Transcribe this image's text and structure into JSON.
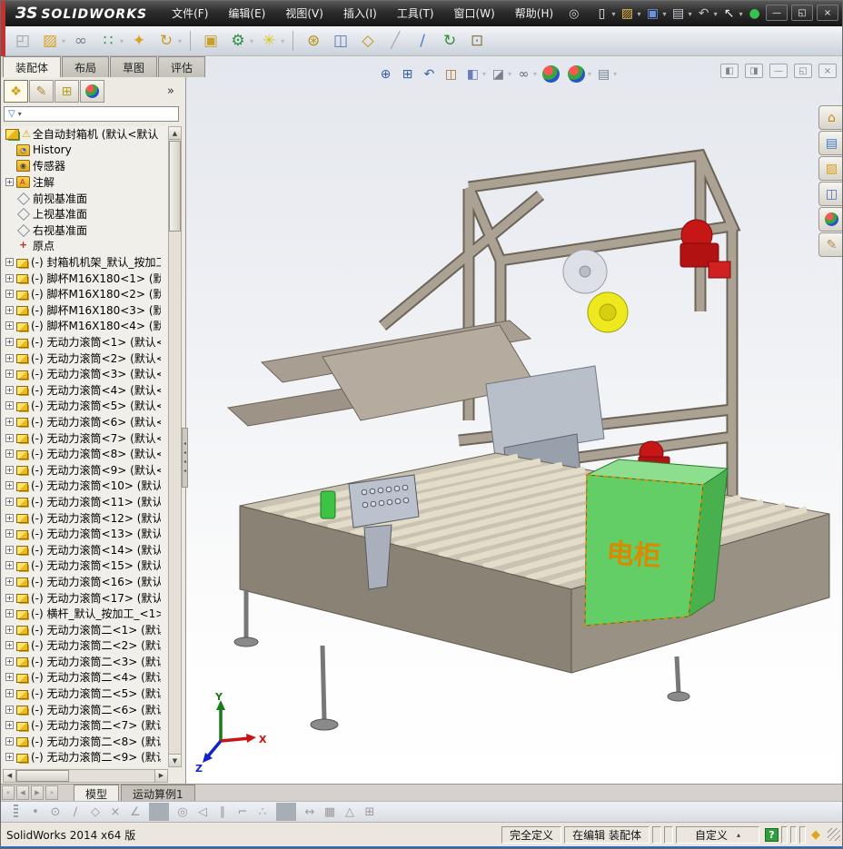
{
  "titlebar": {
    "logo_mark": "ЗS",
    "logo_text": "SOLIDWORKS",
    "menus": [
      {
        "label": "文件(F)"
      },
      {
        "label": "编辑(E)"
      },
      {
        "label": "视图(V)"
      },
      {
        "label": "插入(I)"
      },
      {
        "label": "工具(T)"
      },
      {
        "label": "窗口(W)"
      },
      {
        "label": "帮助(H)"
      }
    ],
    "pin_glyph": "◎",
    "quick_tools": [
      {
        "name": "new-document-button",
        "glyph": "▯",
        "color": "#e8ecf2",
        "dd": "▾"
      },
      {
        "name": "open-button",
        "glyph": "▨",
        "color": "#e8b64a",
        "dd": "▾"
      },
      {
        "name": "save-button",
        "glyph": "▣",
        "color": "#6a93de",
        "dd": "▾"
      },
      {
        "name": "print-button",
        "glyph": "▤",
        "color": "#c9cdd4",
        "dd": "▾"
      },
      {
        "name": "undo-button",
        "glyph": "↶",
        "color": "#b8bcc4",
        "dd": "▾"
      },
      {
        "name": "select-tool-button",
        "glyph": "↖",
        "color": "#f0f0f0",
        "dd": "▾"
      },
      {
        "name": "performance-evaluation-button",
        "glyph": "●",
        "color": "#35c24e"
      },
      {
        "name": "file-properties-button",
        "glyph": "✎",
        "color": "#d8b24a"
      },
      {
        "name": "help-button",
        "glyph": "?",
        "color": "#e8e8e8",
        "dd": "▾"
      }
    ],
    "window_buttons": [
      {
        "name": "minimize-button",
        "glyph": "—"
      },
      {
        "name": "restore-button",
        "glyph": "◱"
      },
      {
        "name": "close-button",
        "glyph": "×"
      }
    ]
  },
  "assembly_toolbar": {
    "items": [
      {
        "name": "insert-components-button",
        "glyph": "◰",
        "color": "#9aa0a8"
      },
      {
        "name": "open-insert-component-button",
        "glyph": "▨",
        "color": "#d8a21f",
        "dd": "▾"
      },
      {
        "name": "mate-button",
        "glyph": "∞",
        "color": "#78808c"
      },
      {
        "name": "linear-component-pattern-button",
        "glyph": "∷",
        "color": "#2f9e2f",
        "dd": "▾"
      },
      {
        "name": "smart-fasteners-button",
        "glyph": "✦",
        "color": "#d8a31d"
      },
      {
        "name": "move-component-button",
        "glyph": "↻",
        "color": "#c89a28",
        "dd": "▾"
      },
      {
        "name": "toolbar-separator",
        "cls": "sep",
        "glyph": ""
      },
      {
        "name": "show-hidden-components-button",
        "glyph": "▣",
        "color": "#c8a030"
      },
      {
        "name": "assembly-features-button",
        "glyph": "⚙",
        "color": "#2f8e3f",
        "dd": "▾"
      },
      {
        "name": "reference-geometry-button",
        "glyph": "✳",
        "color": "#d8c520",
        "dd": "▾"
      },
      {
        "name": "toolbar-separator",
        "cls": "sep",
        "glyph": ""
      },
      {
        "name": "new-motion-study-button",
        "glyph": "⊛",
        "color": "#b89010"
      },
      {
        "name": "bill-of-materials-button",
        "glyph": "◫",
        "color": "#5a7ab0"
      },
      {
        "name": "exploded-view-button",
        "glyph": "◇",
        "color": "#c89010"
      },
      {
        "name": "explode-line-sketch-button",
        "glyph": "╱",
        "color": "#a8adb4"
      },
      {
        "name": "instant3d-button",
        "glyph": "∕",
        "color": "#4a7ac8"
      },
      {
        "name": "update-components-button",
        "glyph": "↻",
        "color": "#3a8a3a"
      },
      {
        "name": "snapshot-button",
        "glyph": "⊡",
        "color": "#8a7a50"
      }
    ]
  },
  "command_tabs": {
    "items": [
      {
        "label": "装配体",
        "active": true
      },
      {
        "label": "布局"
      },
      {
        "label": "草图"
      },
      {
        "label": "评估"
      }
    ]
  },
  "featuremanager": {
    "panel_tabs": [
      {
        "name": "featuremanager-tree-tab",
        "glyph": "❖",
        "color": "#c9a11a",
        "active": true
      },
      {
        "name": "propertymanager-tab",
        "glyph": "✎",
        "color": "#b08830"
      },
      {
        "name": "configurationmanager-tab",
        "glyph": "⊞",
        "color": "#b8a020"
      },
      {
        "name": "displaymanager-tab",
        "glyph": "",
        "cls": "ball"
      }
    ],
    "overflow_glyph": "»",
    "filter_glyph": "▽",
    "filter_dd": "▾",
    "warning_glyph": "⚠",
    "root_label": "全自动封箱机 (默认<默认",
    "scroll": {
      "up": "▲",
      "down": "▼",
      "left": "◀",
      "right": "▶"
    },
    "items": [
      {
        "icon": "history",
        "badge": "◔",
        "label": "History"
      },
      {
        "icon": "sensors",
        "badge": "◉",
        "label": "传感器"
      },
      {
        "icon": "annotations",
        "badge": "A",
        "label": "注解",
        "expand": true
      },
      {
        "icon": "plane",
        "label": "前视基准面"
      },
      {
        "icon": "plane",
        "label": "上视基准面"
      },
      {
        "icon": "plane",
        "label": "右视基准面"
      },
      {
        "icon": "origin",
        "label": "原点"
      },
      {
        "icon": "component",
        "label": "(-) 封箱机机架_默认_按加工",
        "expand": true
      },
      {
        "icon": "component",
        "label": "(-) 脚杯M16X180<1> (默认",
        "expand": true
      },
      {
        "icon": "component",
        "label": "(-) 脚杯M16X180<2> (默认",
        "expand": true
      },
      {
        "icon": "component",
        "label": "(-) 脚杯M16X180<3> (默认",
        "expand": true
      },
      {
        "icon": "component",
        "label": "(-) 脚杯M16X180<4> (默认",
        "expand": true
      },
      {
        "icon": "component",
        "label": "(-) 无动力滚筒<1> (默认<",
        "expand": true
      },
      {
        "icon": "component",
        "label": "(-) 无动力滚筒<2> (默认<",
        "expand": true
      },
      {
        "icon": "component",
        "label": "(-) 无动力滚筒<3> (默认<",
        "expand": true
      },
      {
        "icon": "component",
        "label": "(-) 无动力滚筒<4> (默认<",
        "expand": true
      },
      {
        "icon": "component",
        "label": "(-) 无动力滚筒<5> (默认<",
        "expand": true
      },
      {
        "icon": "component",
        "label": "(-) 无动力滚筒<6> (默认<",
        "expand": true
      },
      {
        "icon": "component",
        "label": "(-) 无动力滚筒<7> (默认<",
        "expand": true
      },
      {
        "icon": "component",
        "label": "(-) 无动力滚筒<8> (默认<",
        "expand": true
      },
      {
        "icon": "component",
        "label": "(-) 无动力滚筒<9> (默认<",
        "expand": true
      },
      {
        "icon": "component",
        "label": "(-) 无动力滚筒<10> (默认",
        "expand": true
      },
      {
        "icon": "component",
        "label": "(-) 无动力滚筒<11> (默认",
        "expand": true
      },
      {
        "icon": "component",
        "label": "(-) 无动力滚筒<12> (默认",
        "expand": true
      },
      {
        "icon": "component",
        "label": "(-) 无动力滚筒<13> (默认",
        "expand": true
      },
      {
        "icon": "component",
        "label": "(-) 无动力滚筒<14> (默认",
        "expand": true
      },
      {
        "icon": "component",
        "label": "(-) 无动力滚筒<15> (默认",
        "expand": true
      },
      {
        "icon": "component",
        "label": "(-) 无动力滚筒<16> (默认",
        "expand": true
      },
      {
        "icon": "component",
        "label": "(-) 无动力滚筒<17> (默认",
        "expand": true
      },
      {
        "icon": "component",
        "label": "(-) 横杆_默认_按加工_<1>",
        "expand": true
      },
      {
        "icon": "component",
        "label": "(-) 无动力滚筒二<1> (默认",
        "expand": true
      },
      {
        "icon": "component",
        "label": "(-) 无动力滚筒二<2> (默认",
        "expand": true
      },
      {
        "icon": "component",
        "label": "(-) 无动力滚筒二<3> (默认",
        "expand": true
      },
      {
        "icon": "component",
        "label": "(-) 无动力滚筒二<4> (默认",
        "expand": true
      },
      {
        "icon": "component",
        "label": "(-) 无动力滚筒二<5> (默认",
        "expand": true
      },
      {
        "icon": "component",
        "label": "(-) 无动力滚筒二<6> (默认",
        "expand": true
      },
      {
        "icon": "component",
        "label": "(-) 无动力滚筒二<7> (默认",
        "expand": true
      },
      {
        "icon": "component",
        "label": "(-) 无动力滚筒二<8> (默认",
        "expand": true
      },
      {
        "icon": "component",
        "label": "(-) 无动力滚筒二<9> (默认",
        "expand": true
      }
    ]
  },
  "headsup_toolbar": {
    "items": [
      {
        "name": "zoom-to-fit-button",
        "glyph": "⊕",
        "color": "#3a5f9e"
      },
      {
        "name": "zoom-to-area-button",
        "glyph": "⊞",
        "color": "#3a5f9e"
      },
      {
        "name": "previous-view-button",
        "glyph": "↶",
        "color": "#3a5f9e"
      },
      {
        "name": "section-view-button",
        "glyph": "◫",
        "color": "#b06a28"
      },
      {
        "name": "view-orientation-button",
        "glyph": "◧",
        "color": "#6a7dbb",
        "dd": "▾"
      },
      {
        "name": "display-style-button",
        "glyph": "◪",
        "color": "#78808e",
        "dd": "▾"
      },
      {
        "name": "hide-show-items-button",
        "glyph": "∞",
        "color": "#606878",
        "dd": "▾"
      },
      {
        "name": "edit-appearance-button",
        "glyph": "",
        "cls": "ball"
      },
      {
        "name": "apply-scene-button",
        "glyph": "",
        "cls": "ball",
        "dd": "▾"
      },
      {
        "name": "view-settings-button",
        "glyph": "▤",
        "color": "#708090",
        "dd": "▾"
      }
    ]
  },
  "doc_window_controls": [
    {
      "name": "pane-collapse-left-button",
      "glyph": "◧"
    },
    {
      "name": "pane-collapse-right-button",
      "glyph": "◨"
    },
    {
      "name": "doc-minimize-button",
      "glyph": "—"
    },
    {
      "name": "doc-restore-button",
      "glyph": "◱"
    },
    {
      "name": "doc-close-button",
      "glyph": "×"
    }
  ],
  "task_pane": {
    "items": [
      {
        "name": "solidworks-resources-tab",
        "glyph": "⌂",
        "color": "#c8881a"
      },
      {
        "name": "design-library-tab",
        "glyph": "▤",
        "color": "#3a7ac8"
      },
      {
        "name": "file-explorer-tab",
        "glyph": "▨",
        "color": "#d9a21f"
      },
      {
        "name": "view-palette-tab",
        "glyph": "◫",
        "color": "#4a6fb8"
      },
      {
        "name": "appearances-scenes-tab",
        "glyph": "",
        "cls": "ball"
      },
      {
        "name": "custom-properties-tab",
        "glyph": "✎",
        "color": "#b09048"
      }
    ]
  },
  "sketch_toolbar": {
    "items": [
      {
        "name": "point-tool-button",
        "glyph": "•"
      },
      {
        "name": "circle-tool-button",
        "glyph": "⊙"
      },
      {
        "name": "line-tool-button",
        "glyph": "∕"
      },
      {
        "name": "polygon-tool-button",
        "glyph": "◇"
      },
      {
        "name": "trim-entities-button",
        "glyph": "×"
      },
      {
        "name": "sketch-angle-button",
        "glyph": "∠"
      },
      {
        "name": "toolbar-separator",
        "cls": "sep",
        "glyph": ""
      },
      {
        "name": "snap-center-button",
        "glyph": "◎"
      },
      {
        "name": "snap-nearest-button",
        "glyph": "◁"
      },
      {
        "name": "snap-parallel-button",
        "glyph": "∥"
      },
      {
        "name": "snap-perpendicular-button",
        "glyph": "⌐"
      },
      {
        "name": "snap-points-button",
        "glyph": "∴"
      },
      {
        "name": "toolbar-separator",
        "cls": "sep",
        "glyph": ""
      },
      {
        "name": "dimension-button",
        "glyph": "↔"
      },
      {
        "name": "grid-button",
        "glyph": "▦"
      },
      {
        "name": "angle-snap-button",
        "glyph": "△"
      },
      {
        "name": "table-button",
        "glyph": "⊞"
      }
    ]
  },
  "bottom_tabs": {
    "nav": [
      "«",
      "◀",
      "▶",
      "»"
    ],
    "tabs": [
      {
        "label": "模型",
        "active": true
      },
      {
        "label": "运动算例1"
      }
    ]
  },
  "status_bar": {
    "app_version": "SolidWorks 2014 x64 版",
    "define_state": "完全定义",
    "edit_state": "在编辑 装配体",
    "custom_label": "自定义",
    "custom_dd": "▴",
    "help_glyph": "?",
    "tag_glyph": "◆"
  },
  "viewport": {
    "cabinet_label": "电柜",
    "triad": {
      "x": "X",
      "y": "Y",
      "z": "Z"
    }
  }
}
